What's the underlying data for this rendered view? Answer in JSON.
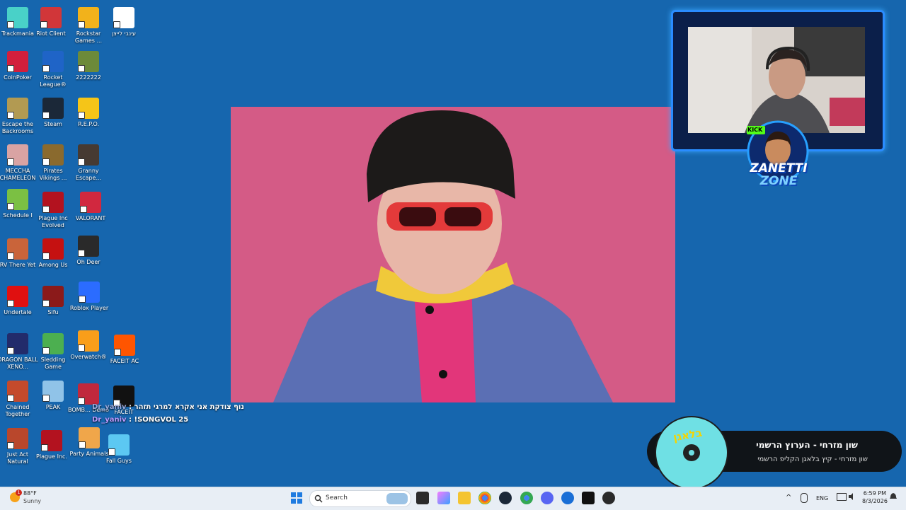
{
  "desktop_icons": [
    {
      "label": "Trackmania",
      "color": "#49d1c8"
    },
    {
      "label": "Riot Client",
      "color": "#d13639"
    },
    {
      "label": "Rockstar Games ...",
      "color": "#f2b21b"
    },
    {
      "label": "עינבי לייצן",
      "color": "#ffffff"
    },
    {
      "label": "CoinPoker",
      "color": "#d21f3c"
    },
    {
      "label": "Rocket League®",
      "color": "#1f64c7"
    },
    {
      "label": "2222222",
      "color": "#6c8a3a"
    },
    {
      "label": "Escape the Backrooms",
      "color": "#b29a52"
    },
    {
      "label": "Steam",
      "color": "#1b2838"
    },
    {
      "label": "R.E.P.O.",
      "color": "#f5c518"
    },
    {
      "label": "MECCHA CHAMELEON",
      "color": "#d9a3a3"
    },
    {
      "label": "Pirates Vikings ...",
      "color": "#8a6a2e"
    },
    {
      "label": "Granny Escape...",
      "color": "#463a32"
    },
    {
      "label": "Schedule I",
      "color": "#7bc043"
    },
    {
      "label": "Plague Inc Evolved",
      "color": "#b3121f"
    },
    {
      "label": "VALORANT",
      "color": "#d1283f"
    },
    {
      "label": "RV There Yet",
      "color": "#c9643a"
    },
    {
      "label": "Among Us",
      "color": "#c51111"
    },
    {
      "label": "Oh Deer",
      "color": "#2a2a2a"
    },
    {
      "label": "Undertale",
      "color": "#e01010"
    },
    {
      "label": "Sifu",
      "color": "#8b1a1a"
    },
    {
      "label": "Roblox Player",
      "color": "#2b6cff"
    },
    {
      "label": "DRAGON BALL XENO...",
      "color": "#222b6b"
    },
    {
      "label": "Sledding Game",
      "color": "#4caf50"
    },
    {
      "label": "Overwatch®",
      "color": "#f99e1a"
    },
    {
      "label": "FACEIT AC",
      "color": "#ff5500"
    },
    {
      "label": "Chained Together",
      "color": "#c44a2c"
    },
    {
      "label": "PEAK",
      "color": "#90c3e8"
    },
    {
      "label": "BOMB... Demo",
      "color": "#c0283d"
    },
    {
      "label": "FACEIT",
      "color": "#111111"
    },
    {
      "label": "Just Act Natural",
      "color": "#b9472c"
    },
    {
      "label": "Plague Inc.",
      "color": "#b3121f"
    },
    {
      "label": "Party Animals",
      "color": "#f0a64a"
    },
    {
      "label": "Fall Guys",
      "color": "#5cc8f2"
    }
  ],
  "chat": [
    {
      "user": "Dr_yaniv",
      "message": "נוף צודקת אני אקרא למרגי תזהר"
    },
    {
      "user": "Dr_yaniv",
      "message": "!SONGVOL 25"
    }
  ],
  "stream_logo": {
    "line1": "ZANETTI",
    "line2": "ZONE",
    "badge": "KICK"
  },
  "now_playing": {
    "title": "שון מזרחי - הערוץ הרשמי",
    "subtitle": "שון מזרחי - קיץ בלאגן הקליפ הרשמי",
    "disc_text": "בלאגן"
  },
  "taskbar": {
    "weather_temp": "88°F",
    "weather_cond": "Sunny",
    "weather_badge": "1",
    "search_placeholder": "Search",
    "lang": "ENG",
    "time": "6:59 PM",
    "date": "8/3/2026"
  },
  "colors": {
    "desktop": "#1666ae",
    "taskbar": "#e8eef5",
    "video_bg": "#d45b86",
    "cam_border": "#2a8cff"
  }
}
